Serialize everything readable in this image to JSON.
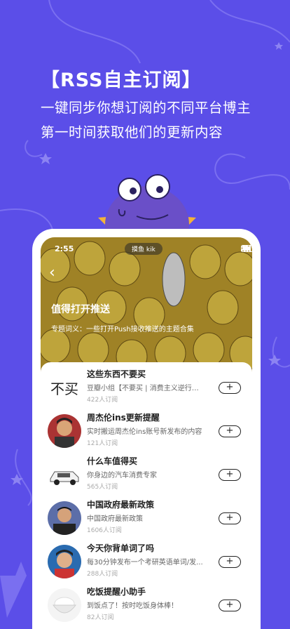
{
  "headline": {
    "title": "【RSS自主订阅】",
    "line1": "一键同步你想订阅的不同平台博主",
    "line2": "第一时间获取他们的更新内容"
  },
  "status_bar": {
    "time": "2:55",
    "pill": "摸鱼 kik"
  },
  "topic": {
    "title": "值得打开推送",
    "subtitle": "专题词义：一些打开Push接收推送的主题合集"
  },
  "items": [
    {
      "name": "这些东西不要买",
      "desc": "豆瓣小组【不要买 | 消费主义逆行者...",
      "count": "422人订阅",
      "thumb_text": "不买",
      "add": "+"
    },
    {
      "name": "周杰伦ins更新提醒",
      "desc": "实时搬运周杰伦ins账号新发布的内容",
      "count": "121人订阅",
      "add": "+"
    },
    {
      "name": "什么车值得买",
      "desc": "你身边的汽车消费专家",
      "count": "565人订阅",
      "add": "+"
    },
    {
      "name": "中国政府最新政策",
      "desc": "中国政府最新政策",
      "count": "1606人订阅",
      "add": "+"
    },
    {
      "name": "今天你背单词了吗",
      "desc": "每30分钟发布一个考研英语单词/发...",
      "count": "288人订阅",
      "add": "+"
    },
    {
      "name": "吃饭提醒小助手",
      "desc": "到饭点了！按时吃饭身体棒！",
      "count": "82人订阅",
      "add": "+"
    }
  ],
  "colors": {
    "background": "#5b4ee8",
    "mascot": "#6a4fc8",
    "fin": "#f3b23a"
  }
}
